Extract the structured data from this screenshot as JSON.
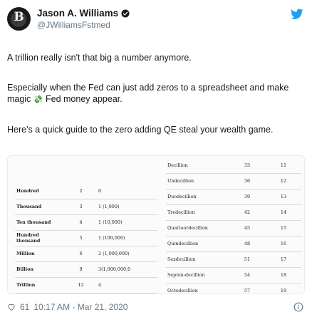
{
  "author": {
    "avatar_letter": "B",
    "name": "Jason A. Williams",
    "handle": "@JWilliamsFstmed",
    "verified_icon": "verified-badge-icon",
    "platform_icon": "twitter-bird-icon"
  },
  "tweet": {
    "line1": "A trillion really isn't that big a number anymore.",
    "line2": "Especially when the Fed can just add zeros to a spreadsheet and make magic ",
    "emoji": "💸",
    "line2_end": " Fed money appear.",
    "line3": "Here's a quick guide to the zero adding QE steal your wealth game."
  },
  "table_left": [
    [
      "Hundred",
      "2",
      "0"
    ],
    [
      "Thousand",
      "3",
      "1 (1,000)"
    ],
    [
      "Ten thousand",
      "4",
      "1 (10,000)"
    ],
    [
      "Hundred thousand",
      "5",
      "1 (100,000)"
    ],
    [
      "Million",
      "6",
      "2 (1,000,000)"
    ],
    [
      "Billion",
      "9",
      "3(1,000,000,0"
    ],
    [
      "Trillion",
      "12",
      "4"
    ],
    [
      "",
      "",
      "(1,000,000,0("
    ]
  ],
  "table_right": [
    [
      "Decillion",
      "33",
      "11"
    ],
    [
      "Undecillion",
      "36",
      "12"
    ],
    [
      "Duodecillion",
      "39",
      "13"
    ],
    [
      "Tredecillion",
      "42",
      "14"
    ],
    [
      "Quattuordecillion",
      "45",
      "15"
    ],
    [
      "Quindecillion",
      "48",
      "16"
    ],
    [
      "Sexdecillion",
      "51",
      "17"
    ],
    [
      "Septen-decillion",
      "54",
      "18"
    ],
    [
      "Octodecillion",
      "57",
      "19"
    ]
  ],
  "footer": {
    "likes": "61",
    "timestamp": "10:17 AM - Mar 21, 2020",
    "heart_icon": "heart-icon",
    "info_icon": "info-icon"
  },
  "colors": {
    "twitter_blue": "#1da1f2",
    "muted": "#657786",
    "text": "#14171a"
  }
}
